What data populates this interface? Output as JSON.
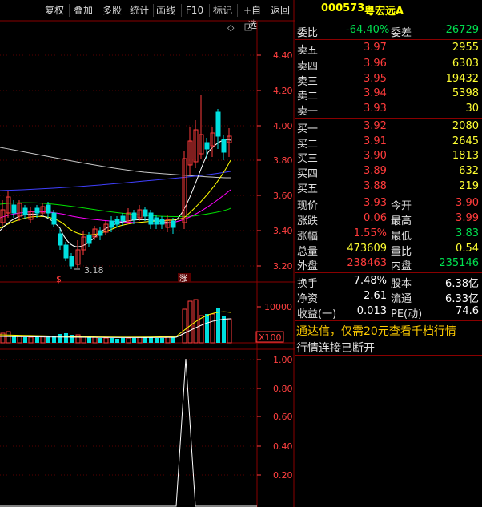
{
  "toolbar": {
    "buttons": [
      "复权",
      "叠加",
      "多股",
      "统计",
      "画线",
      "F10",
      "标记",
      "+自选",
      "返回"
    ]
  },
  "main_chart": {
    "y_ticks": [
      "4.40",
      "4.20",
      "4.00",
      "3.80",
      "3.60",
      "3.40",
      "3.20"
    ],
    "low_label": "3.18",
    "marker_left": "$",
    "marker_right": "涨",
    "diamond": "◇"
  },
  "volume_chart": {
    "tick": "10000",
    "unit": "X100"
  },
  "lower_chart": {
    "y_ticks": [
      "1.00",
      "0.80",
      "0.60",
      "0.40",
      "0.20"
    ]
  },
  "quote": {
    "code": "000573",
    "name": "粤宏远A",
    "ratio_label": "委比",
    "ratio_value": "-64.40%",
    "diff_label": "委差",
    "diff_value": "-26729",
    "asks": [
      {
        "label": "卖五",
        "price": "3.97",
        "volume": "2955"
      },
      {
        "label": "卖四",
        "price": "3.96",
        "volume": "6303"
      },
      {
        "label": "卖三",
        "price": "3.95",
        "volume": "19432"
      },
      {
        "label": "卖二",
        "price": "3.94",
        "volume": "5398"
      },
      {
        "label": "卖一",
        "price": "3.93",
        "volume": "30"
      }
    ],
    "bids": [
      {
        "label": "买一",
        "price": "3.92",
        "volume": "2080"
      },
      {
        "label": "买二",
        "price": "3.91",
        "volume": "2645"
      },
      {
        "label": "买三",
        "price": "3.90",
        "volume": "1813"
      },
      {
        "label": "买四",
        "price": "3.89",
        "volume": "632"
      },
      {
        "label": "买五",
        "price": "3.88",
        "volume": "219"
      }
    ],
    "stats": [
      {
        "l1": "现价",
        "v1": "3.93",
        "l2": "今开",
        "v2": "3.90"
      },
      {
        "l1": "涨跌",
        "v1": "0.06",
        "l2": "最高",
        "v2": "3.99"
      },
      {
        "l1": "涨幅",
        "v1": "1.55%",
        "l2": "最低",
        "v2": "3.83"
      },
      {
        "l1": "总量",
        "v1": "473609",
        "l2": "量比",
        "v2": "0.54"
      },
      {
        "l1": "外盘",
        "v1": "238463",
        "l2": "内盘",
        "v2": "235146"
      }
    ],
    "fund": [
      {
        "l1": "换手",
        "v1": "7.48%",
        "l2": "股本",
        "v2": "6.38亿"
      },
      {
        "l1": "净资",
        "v1": "2.61",
        "l2": "流通",
        "v2": "6.33亿"
      },
      {
        "l1": "收益(一)",
        "v1": "0.013",
        "l2": "PE(动)",
        "v2": "74.6"
      }
    ],
    "promo": "通达信，仅需20元查看千档行情",
    "status": "行情连接已断开"
  },
  "colors": {
    "up": "#ff3b3b",
    "down": "#00e050",
    "ma5": "#ffffff",
    "ma10": "#ffff00",
    "ma20": "#ff00ff",
    "ma30": "#00ff00",
    "ma60": "#4040ff",
    "ma120": "#c8c8c8"
  }
}
